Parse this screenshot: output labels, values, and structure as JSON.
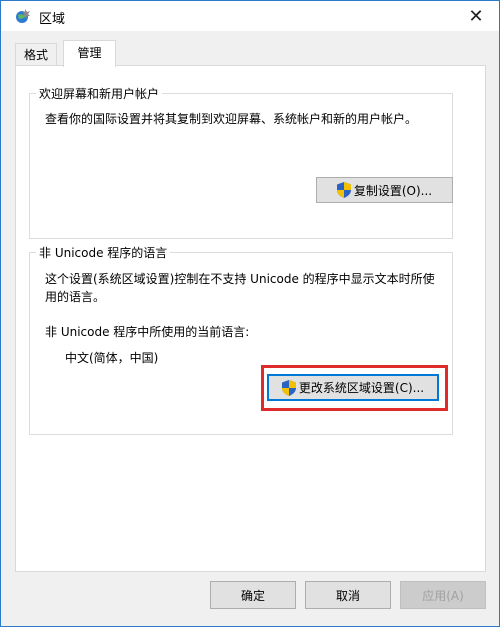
{
  "window": {
    "title": "区域",
    "close_glyph": "✕"
  },
  "tabs": [
    {
      "label": "格式"
    },
    {
      "label": "管理"
    }
  ],
  "welcome_group": {
    "legend": "欢迎屏幕和新用户帐户",
    "description": "查看你的国际设置并将其复制到欢迎屏幕、系统帐户和新的用户帐户。",
    "copy_button": "复制设置(O)..."
  },
  "nonunicode_group": {
    "legend": "非 Unicode 程序的语言",
    "description_line1": "这个设置(系统区域设置)控制在不支持 Unicode 的程序中显示文本时所使",
    "description_line2": "用的语言。",
    "current_label": "非 Unicode 程序中所使用的当前语言:",
    "current_value": "中文(简体，中国)",
    "change_button": "更改系统区域设置(C)..."
  },
  "footer": {
    "ok": "确定",
    "cancel": "取消",
    "apply": "应用(A)"
  },
  "colors": {
    "highlight": "#e02b2b",
    "shield_blue": "#2a63c4",
    "shield_yellow": "#f2c200"
  }
}
